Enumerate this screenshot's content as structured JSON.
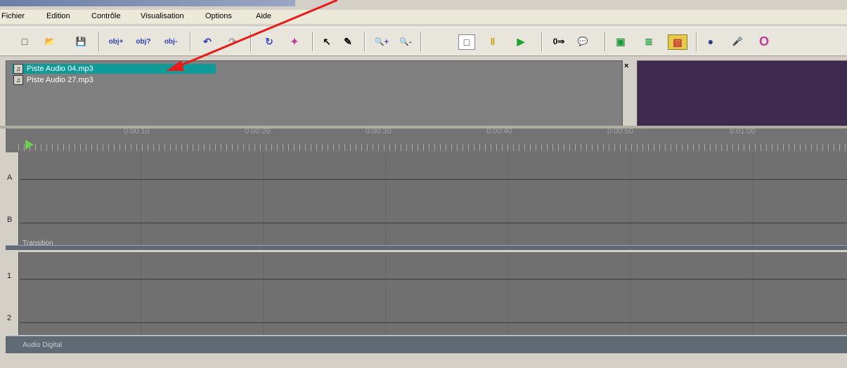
{
  "menu": {
    "items": [
      "Fichier",
      "Edition",
      "Contrôle",
      "Visualisation",
      "Options",
      "Aide"
    ]
  },
  "toolbar": {
    "buttons": [
      {
        "name": "new-icon",
        "glyph": "□"
      },
      {
        "name": "open-icon",
        "glyph": "📂"
      },
      {
        "name": "save-icon",
        "glyph": "💾"
      },
      {
        "name": "obj-add-icon",
        "glyph": "obj+"
      },
      {
        "name": "obj-help-icon",
        "glyph": "obj?"
      },
      {
        "name": "obj-remove-icon",
        "glyph": "obj-"
      },
      {
        "name": "undo-icon",
        "glyph": "↶"
      },
      {
        "name": "redo-icon",
        "glyph": "↷"
      },
      {
        "name": "refresh-icon",
        "glyph": "↻"
      },
      {
        "name": "effect-icon",
        "glyph": "✦"
      },
      {
        "name": "pick-icon",
        "glyph": "↖"
      },
      {
        "name": "pen-icon",
        "glyph": "✎"
      },
      {
        "name": "zoom-in-icon",
        "glyph": "🔍+"
      },
      {
        "name": "zoom-out-icon",
        "glyph": "🔍-"
      },
      {
        "name": "stop-icon",
        "glyph": "□"
      },
      {
        "name": "pause-icon",
        "glyph": "‖"
      },
      {
        "name": "play-icon",
        "glyph": "▶"
      },
      {
        "name": "counter-icon",
        "glyph": "0⇒"
      },
      {
        "name": "comment-icon",
        "glyph": "💬"
      },
      {
        "name": "monitor-icon",
        "glyph": "▣"
      },
      {
        "name": "mixer-icon",
        "glyph": "≣"
      },
      {
        "name": "film-icon",
        "glyph": "▤"
      },
      {
        "name": "record-icon",
        "glyph": "●"
      },
      {
        "name": "mic-icon",
        "glyph": "🎤"
      },
      {
        "name": "loop-icon",
        "glyph": "O"
      }
    ]
  },
  "media_bin": {
    "items": [
      {
        "label": "Piste Audio 04.mp3",
        "selected": true
      },
      {
        "label": "Piste Audio 27.mp3",
        "selected": false
      }
    ],
    "close_label": "×"
  },
  "ruler": {
    "labels": [
      "0:00:10",
      "0:00:20",
      "0:00:30",
      "0:00:40",
      "0:00:50",
      "0:01:00"
    ]
  },
  "tracks": {
    "video": [
      "A",
      "B"
    ],
    "audio": [
      "1",
      "2"
    ]
  },
  "sections": {
    "transition": "Transition",
    "audio_digital": "Audio Digital"
  },
  "colors": {
    "selection": "#0f9a9a",
    "preview": "#3d2a4e",
    "annotation_arrow": "#e81b1b"
  }
}
